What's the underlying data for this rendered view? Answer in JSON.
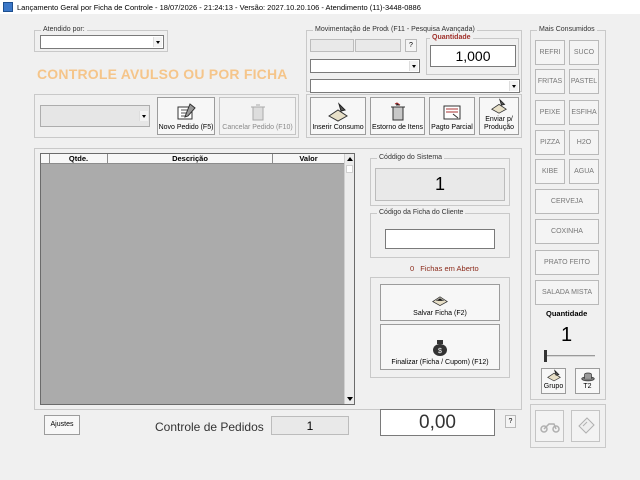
{
  "title_bar": "Lançamento Geral por Ficha de Controle  -  18/07/2026  -  21:24:13  -  Versão: 2027.10.20.106 - Atendimento (11)-3448-0886",
  "atendido": {
    "label": "Atendido por:",
    "value": ""
  },
  "banner": "CONTROLE AVULSO OU POR FICHA",
  "movimentacao": {
    "label": "Movimentação de Produtos",
    "f11_hint": "(F11 - Pesquisa Avançada)",
    "help": "?",
    "quantidade_label": "Quantidade",
    "quantidade_value": "1,000"
  },
  "toolbar": {
    "novo_pedido": "Novo Pedido (F5)",
    "cancelar_pedido": "Cancelar Pedido (F10)",
    "inserir_consumo": "Inserir Consumo",
    "estorno_itens": "Estorno de Itens",
    "pagto_parcial": "Pagto Parcial",
    "enviar_producao_1": "Enviar p/",
    "enviar_producao_2": "Produção"
  },
  "grid": {
    "columns": [
      "Qtde.",
      "Descrição",
      "Valor"
    ],
    "rows": []
  },
  "codigo_sistema": {
    "label": "Códdigo do Sistema",
    "value": "1"
  },
  "codigo_ficha": {
    "label": "Código da Ficha do Cliente",
    "value": ""
  },
  "fichas_aberto": {
    "count": "0",
    "label": "Fichas em Aberto"
  },
  "actions": {
    "salvar": "Salvar Ficha (F2)",
    "finalizar": "Finalizar (Ficha / Cupom) (F12)"
  },
  "bottom": {
    "ajustes": "Ajustes",
    "controle_label": "Controle de Pedidos",
    "controle_value": "1",
    "total": "0,00",
    "help": "?"
  },
  "mais_consumidos": {
    "label": "Mais Consumidos",
    "pairs": [
      [
        "REFRI",
        "SUCO"
      ],
      [
        "FRITAS",
        "PASTEL"
      ],
      [
        "PEIXE",
        "ESFIHA"
      ],
      [
        "PIZZA",
        "H2O"
      ],
      [
        "KIBE",
        "AGUA"
      ]
    ],
    "singles": [
      "CERVEJA",
      "COXINHA",
      "PRATO FEITO",
      "SALADA MISTA"
    ],
    "quantidade_label": "Quantidade",
    "quantidade_value": "1",
    "grupo": "Grupo",
    "t2": "T2"
  },
  "colors": {
    "banner": "#f5c58a",
    "field_border": "#7a7a7a"
  }
}
